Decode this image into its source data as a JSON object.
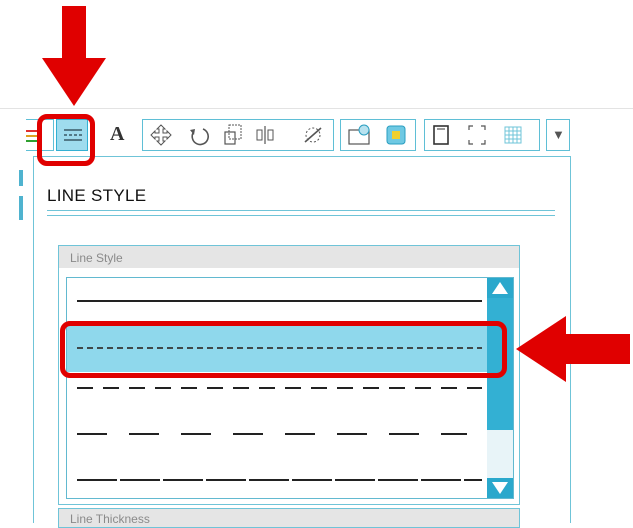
{
  "toolbar": {
    "buttons": [
      {
        "icon": "color-lines-icon"
      },
      {
        "icon": "line-style-icon",
        "active": true
      },
      {
        "icon": "text-icon",
        "label": "A"
      },
      {
        "icon": "move-icon"
      },
      {
        "icon": "rotate-icon"
      },
      {
        "icon": "scale-icon"
      },
      {
        "icon": "align-icon"
      },
      {
        "icon": "effects-icon"
      },
      {
        "icon": "image-icon"
      },
      {
        "icon": "fill-icon"
      },
      {
        "icon": "page-icon"
      },
      {
        "icon": "corners-icon"
      },
      {
        "icon": "grid-icon"
      },
      {
        "icon": "more-icon",
        "label": "▼"
      }
    ]
  },
  "panel": {
    "title": "LINE STYLE",
    "line_style_group": {
      "label": "Line Style",
      "styles": [
        {
          "name": "solid"
        },
        {
          "name": "fine-dash",
          "selected": true
        },
        {
          "name": "medium-dash"
        },
        {
          "name": "long-dash"
        },
        {
          "name": "long-solid-dash"
        }
      ]
    },
    "next_group_label": "Line Thickness"
  },
  "annotation_color": "#e00000",
  "accent_color": "#33b0d3"
}
